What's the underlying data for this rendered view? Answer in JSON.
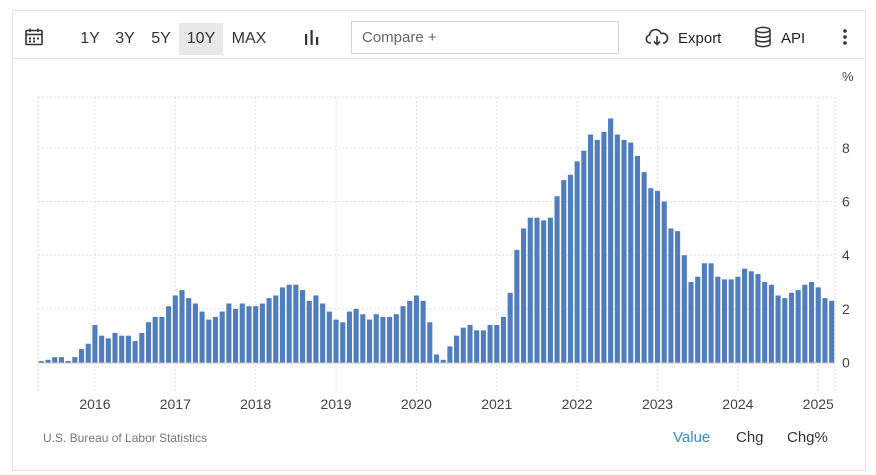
{
  "toolbar": {
    "calendar_icon": "calendar-icon",
    "ranges": [
      "1Y",
      "3Y",
      "5Y",
      "10Y",
      "MAX"
    ],
    "active_range": "10Y",
    "chart_type_icon": "bar-chart-icon",
    "compare_placeholder": "Compare +",
    "export_icon": "cloud-download-icon",
    "export_label": "Export",
    "api_icon": "database-icon",
    "api_label": "API",
    "more_icon": "more-vertical-icon"
  },
  "footer": {
    "source": "U.S. Bureau of Labor Statistics",
    "tabs": [
      "Value",
      "Chg",
      "Chg%"
    ],
    "active_tab": "Value"
  },
  "colors": {
    "bar": "#4f7dbd",
    "accent": "#2f8fd6",
    "grid": "#e0e0e0"
  },
  "chart_data": {
    "type": "bar",
    "unit": "%",
    "ylim": [
      -1.1,
      9.9
    ],
    "yticks": [
      0,
      2,
      4,
      6,
      8
    ],
    "xticks": [
      "2016",
      "2017",
      "2018",
      "2019",
      "2020",
      "2021",
      "2022",
      "2023",
      "2024",
      "2025"
    ],
    "start": "2015-05",
    "end": "2025-04",
    "grid": true,
    "legend": "none",
    "values": [
      0.0,
      0.1,
      0.2,
      0.2,
      0.0,
      0.2,
      0.5,
      0.7,
      1.4,
      1.0,
      0.9,
      1.1,
      1.0,
      1.0,
      0.8,
      1.1,
      1.5,
      1.7,
      1.7,
      2.1,
      2.5,
      2.7,
      2.4,
      2.2,
      1.9,
      1.6,
      1.7,
      1.9,
      2.2,
      2.0,
      2.2,
      2.1,
      2.1,
      2.2,
      2.4,
      2.5,
      2.8,
      2.9,
      2.9,
      2.7,
      2.3,
      2.5,
      2.2,
      1.9,
      1.6,
      1.5,
      1.9,
      2.0,
      1.8,
      1.6,
      1.8,
      1.7,
      1.7,
      1.8,
      2.1,
      2.3,
      2.5,
      2.3,
      1.5,
      0.3,
      0.1,
      0.6,
      1.0,
      1.3,
      1.4,
      1.2,
      1.2,
      1.4,
      1.4,
      1.7,
      2.6,
      4.2,
      5.0,
      5.4,
      5.4,
      5.3,
      5.4,
      6.2,
      6.8,
      7.0,
      7.5,
      7.9,
      8.5,
      8.3,
      8.6,
      9.1,
      8.5,
      8.3,
      8.2,
      7.7,
      7.1,
      6.5,
      6.4,
      6.0,
      5.0,
      4.9,
      4.0,
      3.0,
      3.2,
      3.7,
      3.7,
      3.2,
      3.1,
      3.1,
      3.2,
      3.5,
      3.4,
      3.3,
      3.0,
      2.9,
      2.5,
      2.4,
      2.6,
      2.7,
      2.9,
      3.0,
      2.8,
      2.4,
      2.3
    ]
  }
}
